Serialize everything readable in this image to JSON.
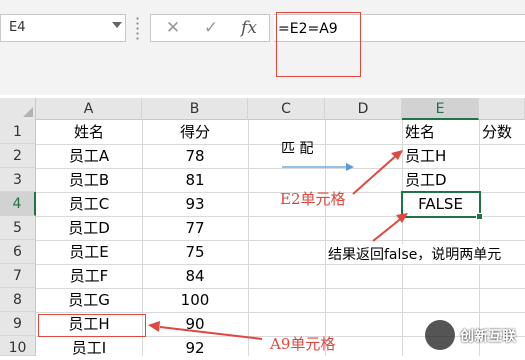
{
  "name_box": "E4",
  "formula_bar": {
    "cancel_icon": "✕",
    "enter_icon": "✓",
    "fx_label": "fx",
    "formula": "=E2=A9"
  },
  "columns": [
    "A",
    "B",
    "C",
    "D",
    "E"
  ],
  "rows": [
    "1",
    "2",
    "3",
    "4",
    "5",
    "6",
    "7",
    "8",
    "9",
    "10"
  ],
  "cells": {
    "A": [
      "姓名",
      "员工A",
      "员工B",
      "员工C",
      "员工D",
      "员工E",
      "员工F",
      "员工G",
      "员工H",
      "员工I"
    ],
    "B": [
      "得分",
      "78",
      "81",
      "93",
      "77",
      "75",
      "84",
      "100",
      "90",
      "92"
    ],
    "E1": "姓名",
    "F1": "分数",
    "E2": "员工H",
    "E3": "员工D",
    "E4": "FALSE"
  },
  "annotations": {
    "match_label": "匹  配",
    "e2_label": "E2单元格",
    "a9_label": "A9单元格",
    "result_note": "结果返回false，说明两单元"
  },
  "watermark": {
    "text": "创新互联"
  },
  "colors": {
    "accent_green": "#217346",
    "annotation_red": "#e0473f",
    "arrow_blue": "#5b9bd5"
  }
}
